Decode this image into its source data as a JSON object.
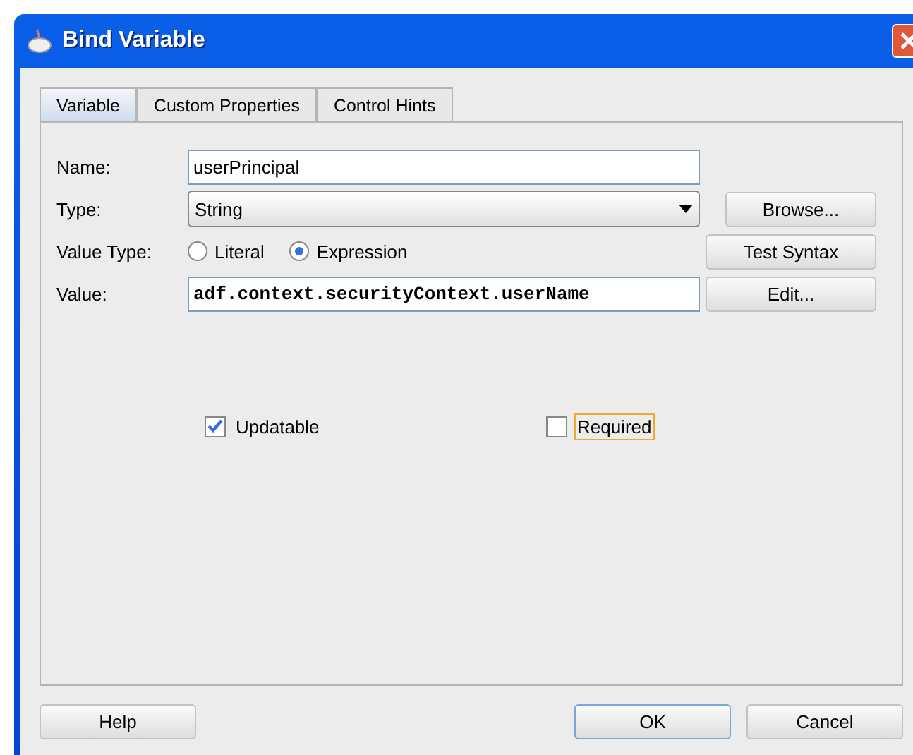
{
  "window": {
    "title": "Bind Variable"
  },
  "tabs": [
    {
      "label": "Variable",
      "selected": true
    },
    {
      "label": "Custom Properties",
      "selected": false
    },
    {
      "label": "Control Hints",
      "selected": false
    }
  ],
  "form": {
    "name": {
      "label": "Name:",
      "value": "userPrincipal"
    },
    "type": {
      "label": "Type:",
      "value": "String",
      "button": "Browse..."
    },
    "value_type": {
      "label": "Value Type:",
      "button": "Test Syntax",
      "options": [
        {
          "label": "Literal",
          "selected": false
        },
        {
          "label": "Expression",
          "selected": true
        }
      ]
    },
    "value": {
      "label": "Value:",
      "value": "adf.context.securityContext.userName",
      "button": "Edit..."
    }
  },
  "checkboxes": [
    {
      "label": "Updatable",
      "checked": true,
      "focused": false
    },
    {
      "label": "Required",
      "checked": false,
      "focused": true
    }
  ],
  "buttons": [
    {
      "label": "Help",
      "default": false
    },
    {
      "label": "OK",
      "default": true
    },
    {
      "label": "Cancel",
      "default": false
    }
  ]
}
